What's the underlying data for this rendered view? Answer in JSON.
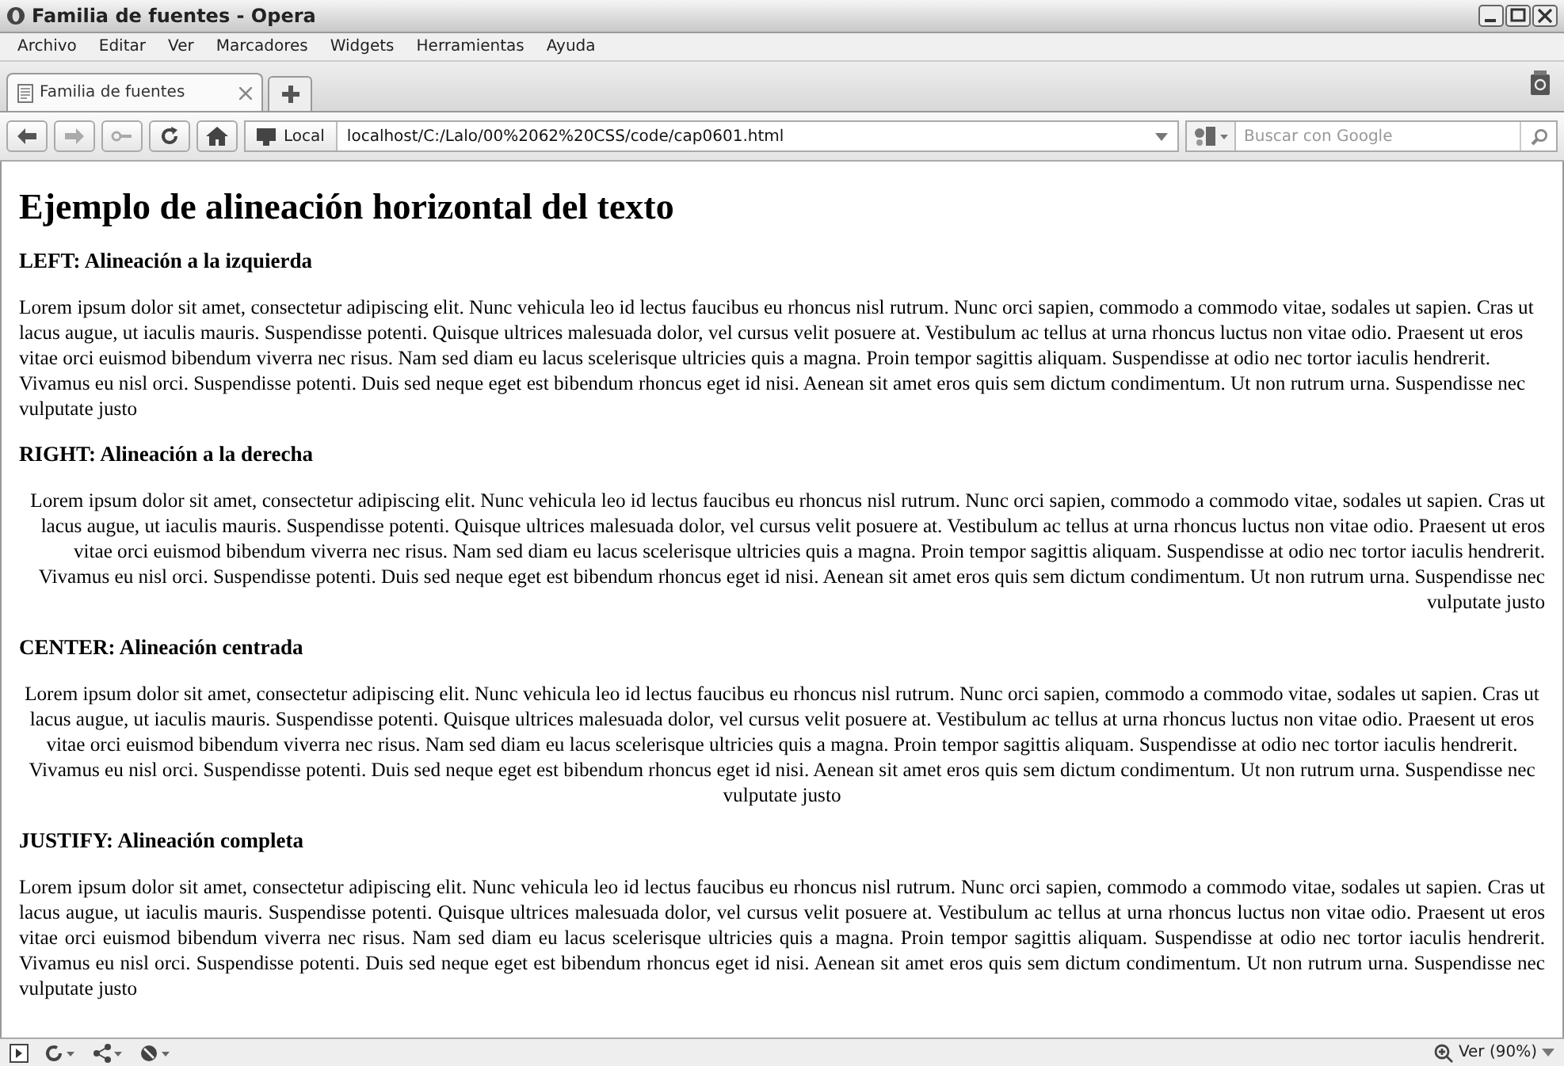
{
  "window": {
    "title": "Familia de fuentes - Opera"
  },
  "menu": [
    "Archivo",
    "Editar",
    "Ver",
    "Marcadores",
    "Widgets",
    "Herramientas",
    "Ayuda"
  ],
  "tabs": [
    {
      "label": "Familia de fuentes",
      "selected": true
    }
  ],
  "address_bar": {
    "badge": "Local",
    "url": "localhost/C:/Lalo/00%2062%20CSS/code/cap0601.html"
  },
  "search": {
    "placeholder": "Buscar con Google"
  },
  "page": {
    "heading": "Ejemplo de alineación horizontal del texto",
    "sections": [
      {
        "title": "LEFT: Alineación a la izquierda",
        "kind": "left",
        "text": "Lorem ipsum dolor sit amet, consectetur adipiscing elit. Nunc vehicula leo id lectus faucibus eu rhoncus nisl rutrum. Nunc orci sapien, commodo a commodo vitae, sodales ut sapien. Cras ut lacus augue, ut iaculis mauris. Suspendisse potenti. Quisque ultrices malesuada dolor, vel cursus velit posuere at. Vestibulum ac tellus at urna rhoncus luctus non vitae odio. Praesent ut eros vitae orci euismod bibendum viverra nec risus. Nam sed diam eu lacus scelerisque ultricies quis a magna. Proin tempor sagittis aliquam. Suspendisse at odio nec tortor iaculis hendrerit. Vivamus eu nisl orci. Suspendisse potenti. Duis sed neque eget est bibendum rhoncus eget id nisi. Aenean sit amet eros quis sem dictum condimentum. Ut non rutrum urna. Suspendisse nec vulputate justo"
      },
      {
        "title": "RIGHT: Alineación a la derecha",
        "kind": "right",
        "text": "Lorem ipsum dolor sit amet, consectetur adipiscing elit. Nunc vehicula leo id lectus faucibus eu rhoncus nisl rutrum. Nunc orci sapien, commodo a commodo vitae, sodales ut sapien. Cras ut lacus augue, ut iaculis mauris. Suspendisse potenti. Quisque ultrices malesuada dolor, vel cursus velit posuere at. Vestibulum ac tellus at urna rhoncus luctus non vitae odio. Praesent ut eros vitae orci euismod bibendum viverra nec risus. Nam sed diam eu lacus scelerisque ultricies quis a magna. Proin tempor sagittis aliquam. Suspendisse at odio nec tortor iaculis hendrerit. Vivamus eu nisl orci. Suspendisse potenti. Duis sed neque eget est bibendum rhoncus eget id nisi. Aenean sit amet eros quis sem dictum condimentum. Ut non rutrum urna. Suspendisse nec vulputate justo"
      },
      {
        "title": "CENTER: Alineación centrada",
        "kind": "center",
        "text": "Lorem ipsum dolor sit amet, consectetur adipiscing elit. Nunc vehicula leo id lectus faucibus eu rhoncus nisl rutrum. Nunc orci sapien, commodo a commodo vitae, sodales ut sapien. Cras ut lacus augue, ut iaculis mauris. Suspendisse potenti. Quisque ultrices malesuada dolor, vel cursus velit posuere at. Vestibulum ac tellus at urna rhoncus luctus non vitae odio. Praesent ut eros vitae orci euismod bibendum viverra nec risus. Nam sed diam eu lacus scelerisque ultricies quis a magna. Proin tempor sagittis aliquam. Suspendisse at odio nec tortor iaculis hendrerit. Vivamus eu nisl orci. Suspendisse potenti. Duis sed neque eget est bibendum rhoncus eget id nisi. Aenean sit amet eros quis sem dictum condimentum. Ut non rutrum urna. Suspendisse nec vulputate justo"
      },
      {
        "title": "JUSTIFY: Alineación completa",
        "kind": "justify",
        "text": "Lorem ipsum dolor sit amet, consectetur adipiscing elit. Nunc vehicula leo id lectus faucibus eu rhoncus nisl rutrum. Nunc orci sapien, commodo a commodo vitae, sodales ut sapien. Cras ut lacus augue, ut iaculis mauris. Suspendisse potenti. Quisque ultrices malesuada dolor, vel cursus velit posuere at. Vestibulum ac tellus at urna rhoncus luctus non vitae odio. Praesent ut eros vitae orci euismod bibendum viverra nec risus. Nam sed diam eu lacus scelerisque ultricies quis a magna. Proin tempor sagittis aliquam. Suspendisse at odio nec tortor iaculis hendrerit. Vivamus eu nisl orci. Suspendisse potenti. Duis sed neque eget est bibendum rhoncus eget id nisi. Aenean sit amet eros quis sem dictum condimentum. Ut non rutrum urna. Suspendisse nec vulputate justo"
      }
    ]
  },
  "status_bar": {
    "zoom": "Ver (90%)"
  }
}
